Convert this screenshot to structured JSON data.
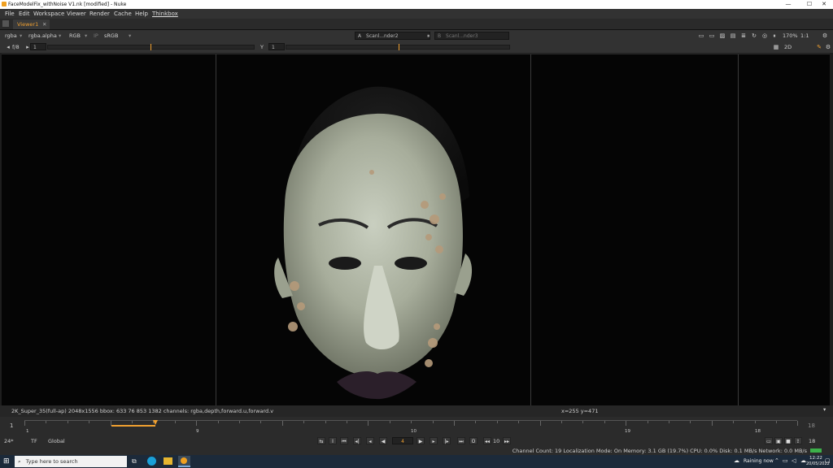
{
  "window": {
    "title": "FaceModelFix_withNoise V1.nk [modified] - Nuke",
    "minimize": "—",
    "maximize": "☐",
    "close": "✕"
  },
  "menu": [
    "File",
    "Edit",
    "Workspace",
    "Viewer",
    "Render",
    "Cache",
    "Help",
    "Thinkbox"
  ],
  "tab": {
    "label": "Viewer1",
    "close": "✕"
  },
  "viewer_controls": {
    "channels": "rgba",
    "alpha": "rgba.alpha",
    "display": "RGB",
    "ip": "IP",
    "colorspace": "sRGB",
    "input_a_label": "A",
    "input_a": "Scanl...nder2",
    "input_b_label": "B",
    "input_b": "Scanl...nder3",
    "zoom": "170%",
    "proxy": "1:1",
    "fstop": "f/8",
    "gain": "1",
    "y_label": "Y",
    "gamma": "1",
    "view_mode": "2D"
  },
  "info": {
    "format": "2K_Super_35(full-ap) 2048x1556  bbox: 633 76 853 1382 channels: rgba,depth,forward.u,forward.v",
    "coords": "x=255 y=471"
  },
  "timeline": {
    "start": "1",
    "end": "18",
    "current": "4",
    "ticks": [
      "1",
      "9",
      "10",
      "19",
      "18"
    ],
    "playback_increment": "10"
  },
  "controls": {
    "fps": "24*",
    "tf": "TF",
    "global": "Global",
    "last_frame": "18"
  },
  "status": "Channel Count: 19  Localization Mode: On  Memory: 3.1 GB (19.7%)  CPU: 0.0%  Disk: 0.1 MB/s  Network: 0.0 MB/s",
  "taskbar": {
    "search_placeholder": "Type here to search",
    "weather": "Raining now",
    "time": "12:22",
    "date": "20/05/2022"
  },
  "colors": {
    "accent": "#f0a030",
    "taskbar": "#1c2a3a"
  }
}
